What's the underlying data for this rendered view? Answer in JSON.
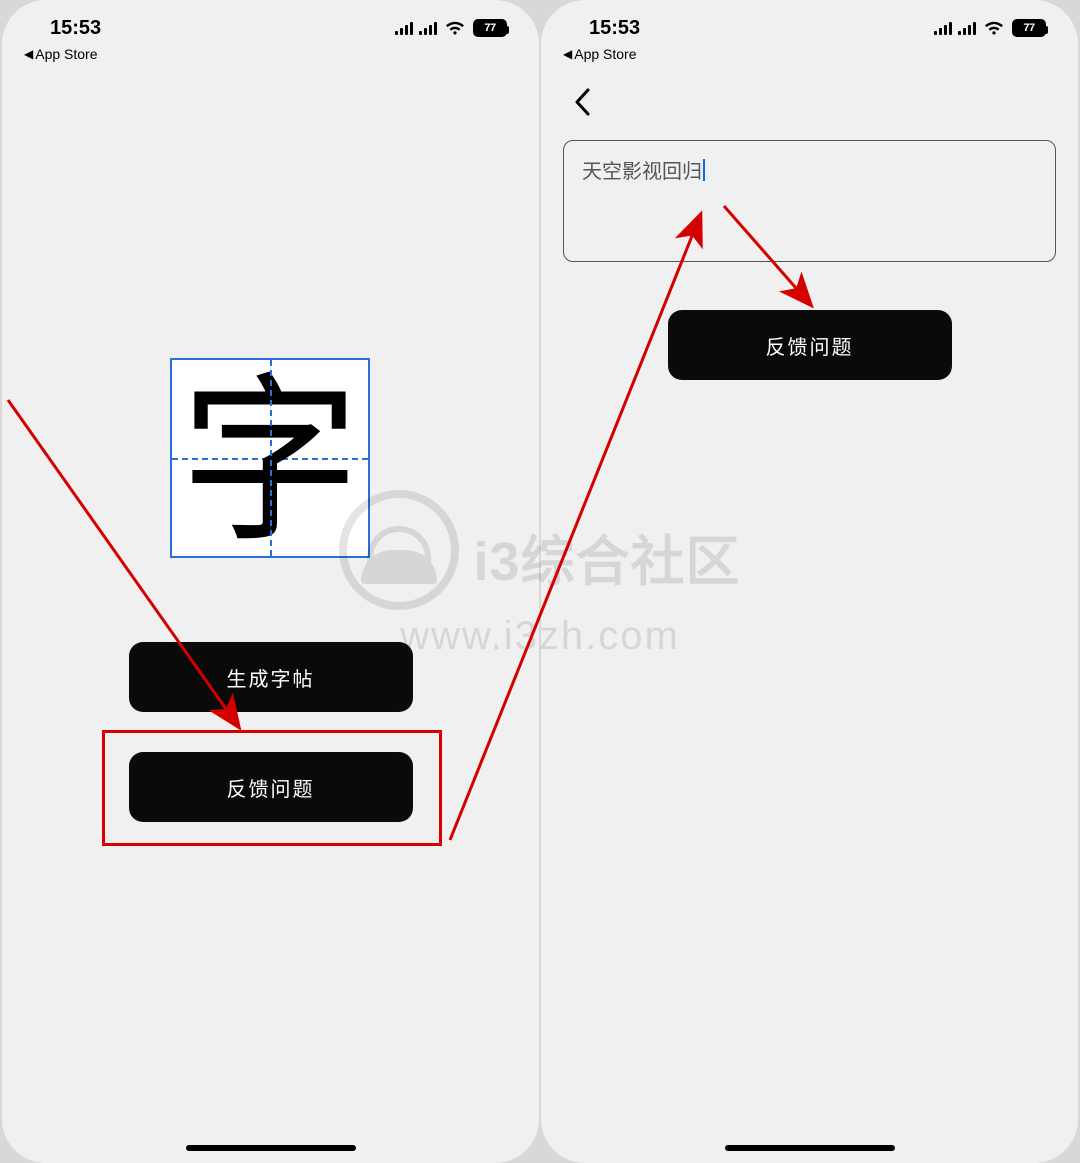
{
  "status": {
    "time": "15:53",
    "back_app": "App Store",
    "battery": "77"
  },
  "screen1": {
    "character": "字",
    "generate_button": "生成字帖",
    "feedback_button": "反馈问题"
  },
  "screen2": {
    "input_text": "天空影视回归",
    "submit_button": "反馈问题"
  },
  "watermark": {
    "line1": "i3综合社区",
    "line2": "www.i3zh.com"
  }
}
